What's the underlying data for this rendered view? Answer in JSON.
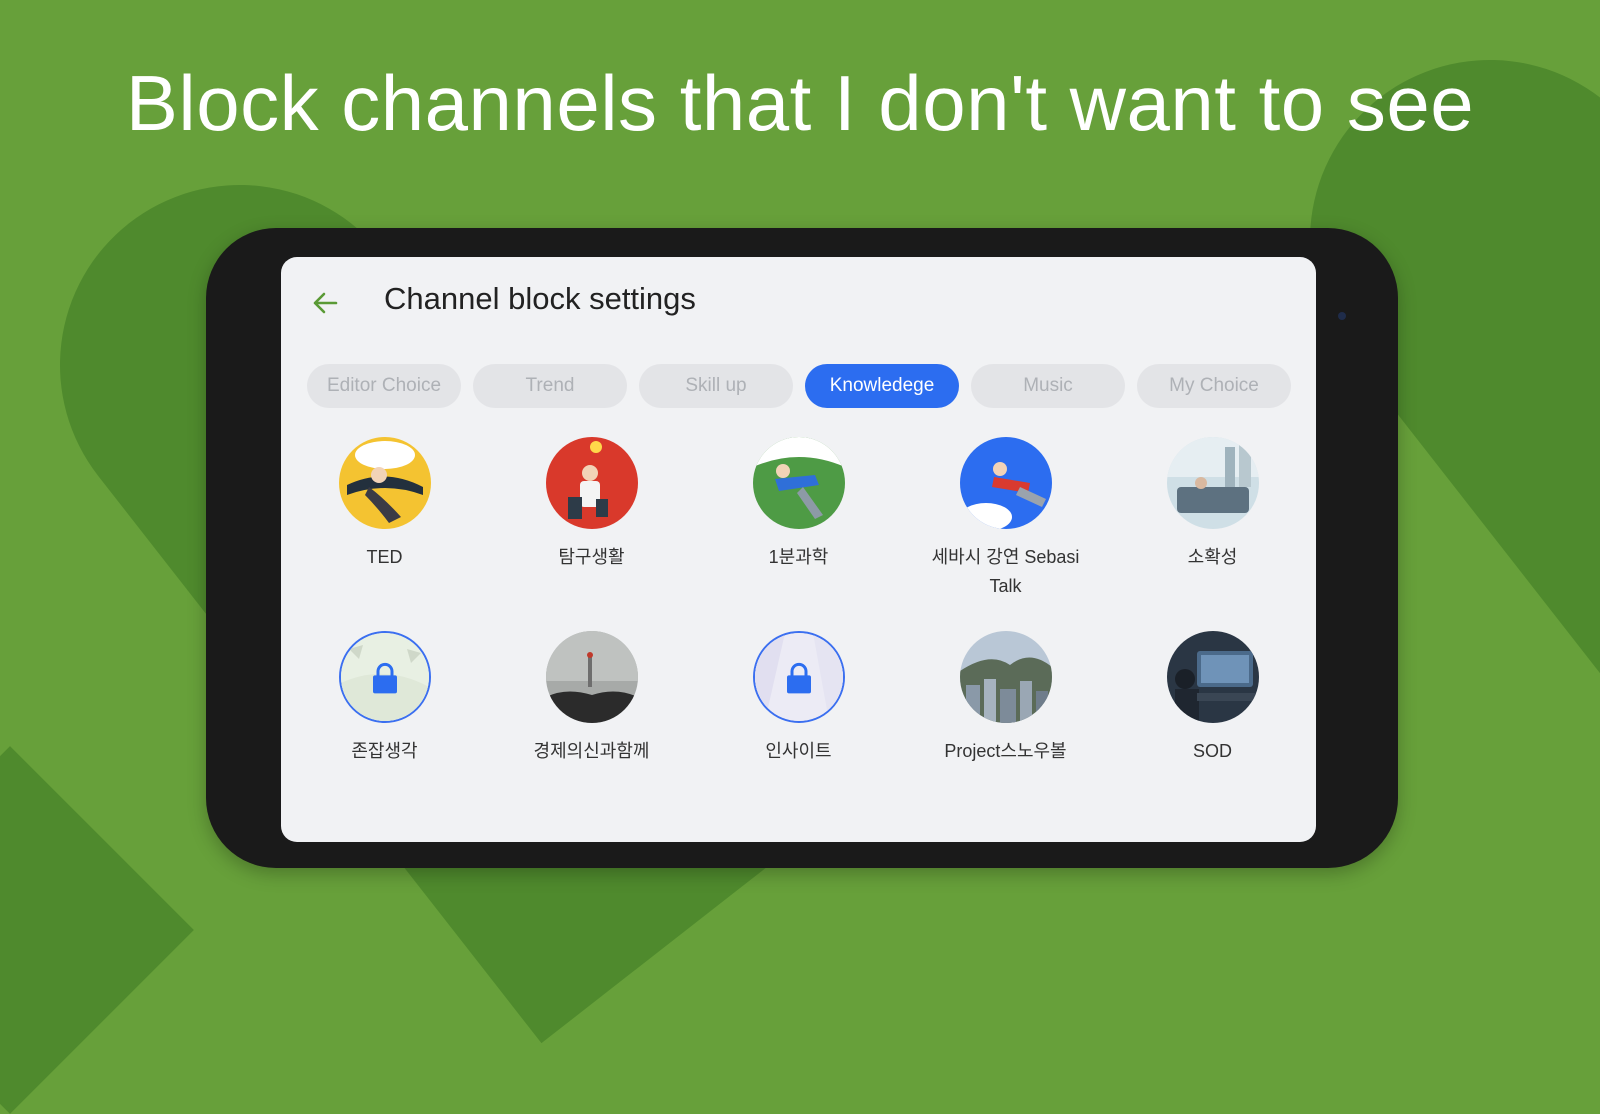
{
  "headline": "Block channels that I don't want to see",
  "header": {
    "back_icon": "arrow-left-icon",
    "title": "Channel block settings"
  },
  "tabs": [
    {
      "label": "Editor Choice",
      "active": false
    },
    {
      "label": "Trend",
      "active": false
    },
    {
      "label": "Skill up",
      "active": false
    },
    {
      "label": "Knowledege",
      "active": true
    },
    {
      "label": "Music",
      "active": false
    },
    {
      "label": "My Choice",
      "active": false
    }
  ],
  "channels": [
    {
      "name": "TED",
      "blocked": false
    },
    {
      "name": "탐구생활",
      "blocked": false
    },
    {
      "name": "1분과학",
      "blocked": false
    },
    {
      "name": "세바시 강연 Sebasi Talk",
      "blocked": false
    },
    {
      "name": "소확성",
      "blocked": false
    },
    {
      "name": "존잡생각",
      "blocked": true
    },
    {
      "name": "경제의신과함께",
      "blocked": false
    },
    {
      "name": "인사이트",
      "blocked": true
    },
    {
      "name": "Project스노우볼",
      "blocked": false
    },
    {
      "name": "SOD",
      "blocked": false
    }
  ],
  "colors": {
    "background": "#67a03a",
    "accent": "#2c6df0",
    "back_arrow": "#5a9a35"
  }
}
